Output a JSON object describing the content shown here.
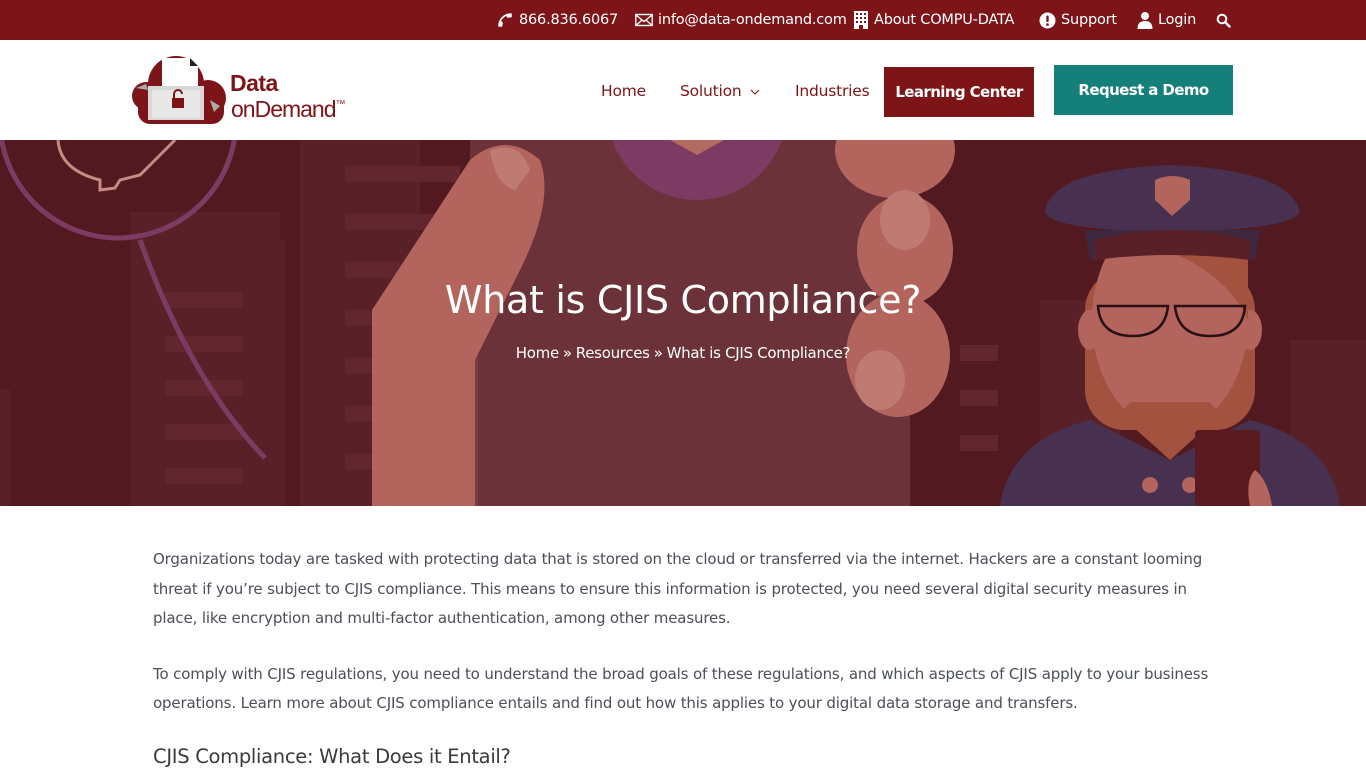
{
  "topbar": {
    "phone": "866.836.6067",
    "email": "info@data-ondemand.com",
    "about": "About COMPU-DATA",
    "support": "Support",
    "login": "Login",
    "icons": {
      "phone": "phone-icon",
      "email": "envelope-icon",
      "about": "building-icon",
      "support": "exclamation-circle-icon",
      "login": "user-icon",
      "search": "search-icon"
    }
  },
  "logo": {
    "line1": "Data",
    "line2": "onDemand",
    "trademark": "™"
  },
  "nav": {
    "home": "Home",
    "solution": "Solution",
    "industries": "Industries",
    "learning_center": "Learning Center",
    "request_demo": "Request a Demo"
  },
  "hero": {
    "title": "What is CJIS Compliance?",
    "breadcrumb": {
      "home": "Home",
      "separator": "»",
      "resources": "Resources",
      "current": "What is CJIS Compliance?"
    }
  },
  "content": {
    "paragraphs": [
      "Organizations today are tasked with protecting data that is stored on the cloud or transferred via the internet. Hackers are a constant looming threat if you’re subject to CJIS compliance. This means to ensure this information is protected, you need several digital security measures in place, like encryption and multi-factor authentication, among other measures.",
      "To comply with CJIS regulations, you need to understand the broad goals of these regulations, and which aspects of CJIS apply to your business operations. Learn more about CJIS compliance entails and find out how this applies to your digital data storage and transfers."
    ],
    "heading": "CJIS Compliance: What Does it Entail?"
  },
  "colors": {
    "brand_red": "#7d1518",
    "teal": "#157f7a",
    "hero_bg": "#521a20"
  }
}
